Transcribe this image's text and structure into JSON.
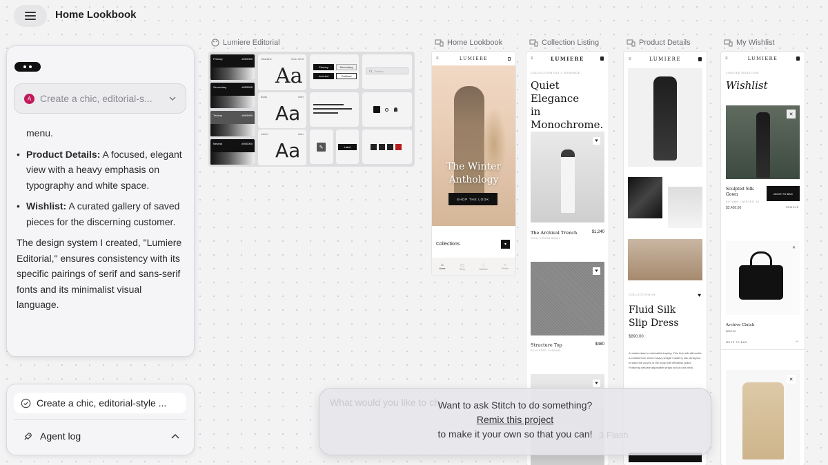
{
  "header": {
    "title": "Home Lookbook"
  },
  "chat": {
    "prompt_chip": "Create a chic, editorial-s...",
    "avatar_initial": "A",
    "partial_line": "menu.",
    "items": [
      {
        "label": "Product Details:",
        "text": " A focused, elegant view with a heavy emphasis on typography and white space."
      },
      {
        "label": "Wishlist:",
        "text": " A curated gallery of saved pieces for the discerning customer."
      }
    ],
    "paragraph": "The design system I created, \"Lumiere Editorial,\" ensures consistency with its specific pairings of serif and sans-serif fonts and its minimalist visual language."
  },
  "agent": {
    "prompt": "Create a chic, editorial-style ...",
    "log_label": "Agent log"
  },
  "frames": {
    "editorial": "Lumiere Editorial",
    "home": "Home Lookbook",
    "collection": "Collection Listing",
    "product": "Product Details",
    "wishlist": "My Wishlist"
  },
  "editorial_board": {
    "swatches": [
      {
        "label": "Primary",
        "hex": "#000000"
      },
      {
        "label": "Secondary",
        "hex": "#555555"
      },
      {
        "label": "Tertiary",
        "hex": "#999999"
      },
      {
        "label": "Neutral",
        "hex": "#000000"
      }
    ],
    "type_samples": [
      {
        "sample": "Aa",
        "role": "Headline",
        "font": "Noto Serif"
      },
      {
        "sample": "Aa",
        "role": "Body",
        "font": "Inter"
      },
      {
        "sample": "Aa",
        "role": "Label",
        "font": "Inter"
      }
    ],
    "buttons": [
      "Primary",
      "Secondary",
      "Inverted",
      "Outlined"
    ],
    "search_placeholder": "Search",
    "label_chip": "Label"
  },
  "home": {
    "brand": "LUMIERE",
    "hero_title_1": "The Winter",
    "hero_title_2": "Anthology",
    "cta": "SHOP THE LOOK",
    "collections": "Collections",
    "nav": [
      "Home",
      "Shop",
      "Wishlist",
      "Profile"
    ]
  },
  "collection": {
    "brand": "LUMIERE",
    "kicker": "COLLECTION 024 // ESSENCE",
    "title_1": "Quiet Elegance",
    "title_2": "in",
    "title_3": "Monochrome.",
    "products": [
      {
        "name": "The Archival Trench",
        "price": "$1,240",
        "sub": "100% VIRGIN WOOL"
      },
      {
        "name": "Structure Top",
        "price": "$480",
        "sub": "SCULPTED CANVAS"
      }
    ]
  },
  "product": {
    "brand": "LUMIERE",
    "kicker": "COLLECTION 04",
    "title_1": "Fluid Silk",
    "title_2": "Slip Dress",
    "price": "$890.00",
    "description": "A masterclass in minimalist draping. This fluid silk silhouette is crafted from 22mm heavy-weight mulberry silk, designed to trace the curves of the body with effortless grace. Featuring delicate adjustable straps and a cowl-neck."
  },
  "wishlist": {
    "brand": "LUMIERE",
    "kicker": "CURATED SELECTION",
    "title": "Wishlist",
    "items": [
      {
        "name": "Sculpted Silk Gown",
        "sub": "AUTUMN / WINTER '24",
        "price": "$2,450.00",
        "button": "MOVE TO BAG",
        "remove": "REMOVE"
      },
      {
        "name": "Archive Clutch",
        "price": "$890.00",
        "action": "MOVE TO BAG"
      }
    ]
  },
  "ask_overlay": {
    "ghost_placeholder": "What would you like to ch",
    "line1": "Want to ask Stitch to do something?",
    "link": "Remix this project",
    "line3": "to make it your own so that you can!",
    "model_ghost": "3 Flash"
  }
}
